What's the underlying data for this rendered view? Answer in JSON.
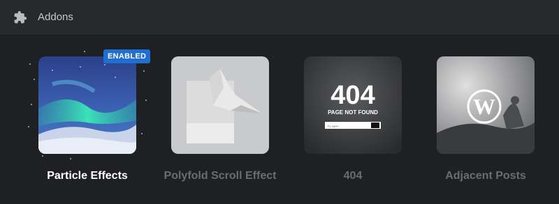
{
  "header": {
    "title": "Addons",
    "icon": "puzzle-icon"
  },
  "addons": [
    {
      "name": "Particle Effects",
      "status": "ENABLED",
      "enabled": true
    },
    {
      "name": "Polyfold Scroll Effect",
      "enabled": false
    },
    {
      "name": "404",
      "enabled": false,
      "thumb_title": "404",
      "thumb_subtitle": "PAGE NOT FOUND",
      "thumb_input_placeholder": "Try again..."
    },
    {
      "name": "Adjacent Posts",
      "enabled": false
    }
  ],
  "colors": {
    "background": "#1f2023",
    "header": "#28292d",
    "badge": "#1f6fd1",
    "active_label": "#ffffff",
    "inactive_label": "#6a6c71"
  }
}
